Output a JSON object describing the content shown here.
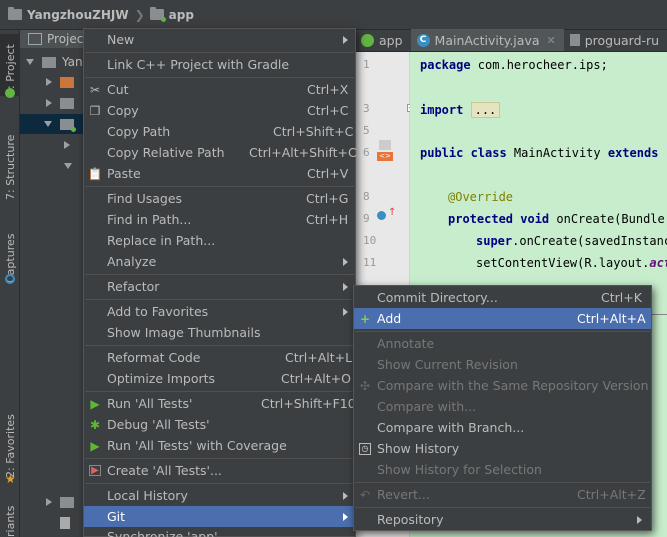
{
  "nav": {
    "project": "YangzhouZHJW",
    "module": "app"
  },
  "tool_windows": {
    "project_tab": "1: Project",
    "structure_tab": "7: Structure",
    "captures_tab": "Captures",
    "favorites_tab": "2: Favorites",
    "variants_tab": "riants"
  },
  "project_panel": {
    "header": "Projec",
    "root": "Yan"
  },
  "editor": {
    "tabs": [
      {
        "label": "app"
      },
      {
        "label": "MainActivity.java"
      },
      {
        "label": "proguard-ru"
      }
    ],
    "line_numbers": [
      "1",
      "3",
      "5",
      "6",
      "8",
      "9",
      "10",
      "11"
    ],
    "code": {
      "package_kw": "package",
      "package_name": " com.herocheer.ips;",
      "import_kw": "import",
      "import_fold": "...",
      "class_mods": "public class",
      "class_name": " MainActivity ",
      "extends_kw": "extends",
      "override": "@Override",
      "method_mods": "protected void",
      "method_sig": " onCreate(Bundle",
      "super_kw": "super",
      "super_call": ".onCreate(savedInstanc",
      "set_content": "setContentView(R.layout.",
      "set_content_tail": "act"
    }
  },
  "context_menu": {
    "items": [
      {
        "label": "New"
      },
      {
        "label": "Link C++ Project with Gradle"
      },
      {
        "label": "Cut",
        "shortcut": "Ctrl+X"
      },
      {
        "label": "Copy",
        "shortcut": "Ctrl+C"
      },
      {
        "label": "Copy Path",
        "shortcut": "Ctrl+Shift+C"
      },
      {
        "label": "Copy Relative Path",
        "shortcut": "Ctrl+Alt+Shift+C"
      },
      {
        "label": "Paste",
        "shortcut": "Ctrl+V"
      },
      {
        "label": "Find Usages",
        "shortcut": "Ctrl+G"
      },
      {
        "label": "Find in Path...",
        "shortcut": "Ctrl+H"
      },
      {
        "label": "Replace in Path..."
      },
      {
        "label": "Analyze"
      },
      {
        "label": "Refactor"
      },
      {
        "label": "Add to Favorites"
      },
      {
        "label": "Show Image Thumbnails"
      },
      {
        "label": "Reformat Code",
        "shortcut": "Ctrl+Alt+L"
      },
      {
        "label": "Optimize Imports",
        "shortcut": "Ctrl+Alt+O"
      },
      {
        "label": "Run 'All Tests'",
        "shortcut": "Ctrl+Shift+F10"
      },
      {
        "label": "Debug 'All Tests'"
      },
      {
        "label": "Run 'All Tests' with Coverage"
      },
      {
        "label": "Create 'All Tests'..."
      },
      {
        "label": "Local History"
      },
      {
        "label": "Git"
      },
      {
        "label": "Synchronize 'app'"
      }
    ]
  },
  "git_menu": {
    "items": [
      {
        "label": "Commit Directory...",
        "shortcut": "Ctrl+K"
      },
      {
        "label": "Add",
        "shortcut": "Ctrl+Alt+A"
      },
      {
        "label": "Annotate"
      },
      {
        "label": "Show Current Revision"
      },
      {
        "label": "Compare with the Same Repository Version"
      },
      {
        "label": "Compare with..."
      },
      {
        "label": "Compare with Branch..."
      },
      {
        "label": "Show History"
      },
      {
        "label": "Show History for Selection"
      },
      {
        "label": "Revert...",
        "shortcut": "Ctrl+Alt+Z"
      },
      {
        "label": "Repository"
      }
    ]
  },
  "colors": {
    "menu_bg": "#3c3f41",
    "highlight": "#4b6eaf",
    "editor_bg": "#c7edcc",
    "disabled_text": "#777777"
  }
}
